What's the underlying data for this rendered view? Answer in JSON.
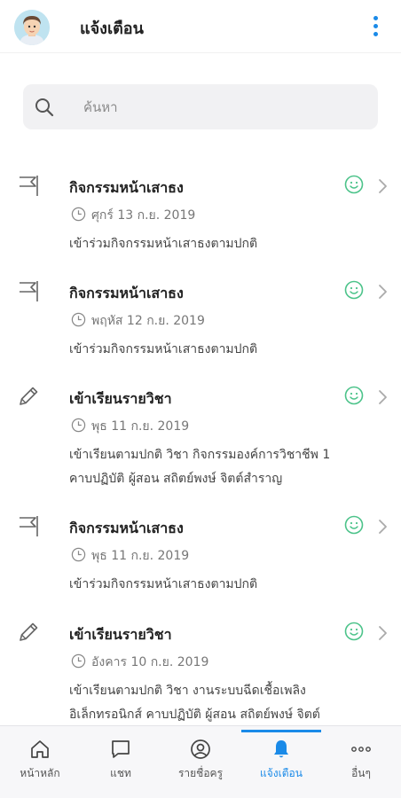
{
  "header": {
    "title": "แจ้งเตือน",
    "avatar_icon": "user-avatar-icon",
    "more_icon": "more-vertical-icon"
  },
  "search": {
    "placeholder": "ค้นหา",
    "value": ""
  },
  "notifications": [
    {
      "icon": "flag-icon",
      "title": "กิจกรรมหน้าเสาธง",
      "date": "ศุกร์ 13 ก.ย. 2019",
      "description": "เข้าร่วมกิจกรรมหน้าเสาธงตามปกติ",
      "status_icon": "smile-icon"
    },
    {
      "icon": "flag-icon",
      "title": "กิจกรรมหน้าเสาธง",
      "date": "พฤหัส 12 ก.ย. 2019",
      "description": "เข้าร่วมกิจกรรมหน้าเสาธงตามปกติ",
      "status_icon": "smile-icon"
    },
    {
      "icon": "pencil-icon",
      "title": "เข้าเรียนรายวิชา",
      "date": "พุธ 11 ก.ย. 2019",
      "description": "เข้าเรียนตามปกติ วิชา กิจกรรมองค์การวิชาชีพ 1 คาบปฏิบัติ ผู้สอน สถิตย์พงษ์ จิตต์สำราญ",
      "status_icon": "smile-icon"
    },
    {
      "icon": "flag-icon",
      "title": "กิจกรรมหน้าเสาธง",
      "date": "พุธ 11 ก.ย. 2019",
      "description": "เข้าร่วมกิจกรรมหน้าเสาธงตามปกติ",
      "status_icon": "smile-icon"
    },
    {
      "icon": "pencil-icon",
      "title": "เข้าเรียนรายวิชา",
      "date": "อังคาร 10 ก.ย. 2019",
      "description": "เข้าเรียนตามปกติ วิชา งานระบบฉีดเชื้อเพลิงอิเล็กทรอนิกส์ คาบปฏิบัติ ผู้สอน สถิตย์พงษ์ จิตต์",
      "status_icon": "smile-icon"
    }
  ],
  "bottom_nav": [
    {
      "label": "หน้าหลัก",
      "icon": "home-icon",
      "active": false
    },
    {
      "label": "แชท",
      "icon": "chat-icon",
      "active": false
    },
    {
      "label": "รายชื่อครู",
      "icon": "user-circle-icon",
      "active": false
    },
    {
      "label": "แจ้งเตือน",
      "icon": "bell-icon",
      "active": true
    },
    {
      "label": "อื่นๆ",
      "icon": "more-horizontal-icon",
      "active": false
    }
  ],
  "colors": {
    "accent": "#1a8ae8",
    "status_ok": "#4cc38a",
    "icon_gray": "#8a8a8a"
  }
}
